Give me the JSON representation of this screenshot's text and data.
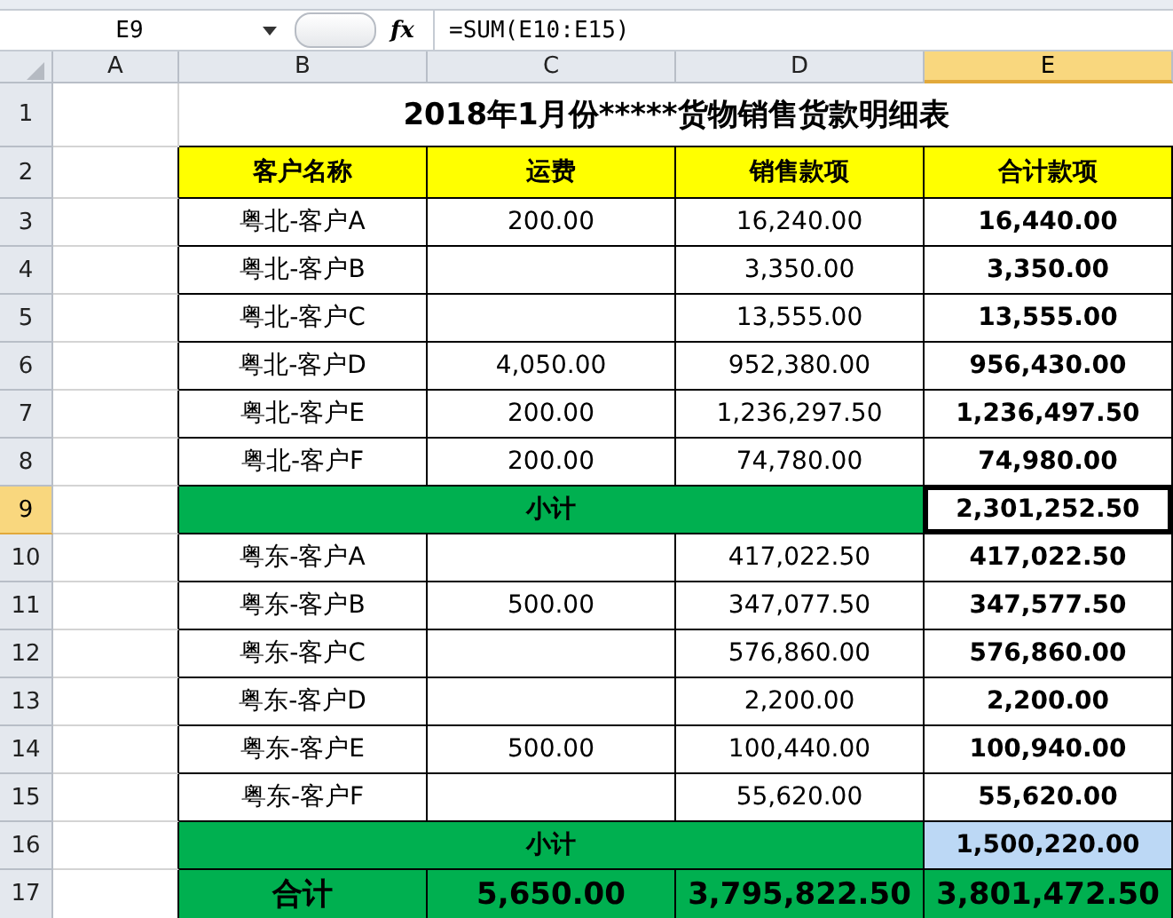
{
  "formula_bar": {
    "cell_ref": "E9",
    "function_symbol": "fx",
    "formula": "=SUM(E10:E15)"
  },
  "columns": [
    {
      "label": "A",
      "selected": false
    },
    {
      "label": "B",
      "selected": false
    },
    {
      "label": "C",
      "selected": false
    },
    {
      "label": "D",
      "selected": false
    },
    {
      "label": "E",
      "selected": true
    }
  ],
  "rows": [
    {
      "number": "1",
      "selected": false,
      "kind": "title",
      "cells": [
        {
          "text": "2018年1月份*****货物销售货款明细表"
        }
      ]
    },
    {
      "number": "2",
      "selected": false,
      "kind": "header",
      "cells": [
        {
          "text": "客户名称"
        },
        {
          "text": "运费"
        },
        {
          "text": "销售款项"
        },
        {
          "text": "合计款项"
        }
      ]
    },
    {
      "number": "3",
      "selected": false,
      "kind": "data",
      "cells": [
        {
          "text": "粤北-客户A"
        },
        {
          "text": "200.00"
        },
        {
          "text": "16,240.00"
        },
        {
          "text": "16,440.00",
          "active": false,
          "highlighted": false
        }
      ]
    },
    {
      "number": "4",
      "selected": false,
      "kind": "data",
      "cells": [
        {
          "text": "粤北-客户B"
        },
        {},
        {
          "text": "3,350.00"
        },
        {
          "text": "3,350.00",
          "active": false,
          "highlighted": false
        }
      ]
    },
    {
      "number": "5",
      "selected": false,
      "kind": "data",
      "cells": [
        {
          "text": "粤北-客户C"
        },
        {},
        {
          "text": "13,555.00"
        },
        {
          "text": "13,555.00",
          "active": false,
          "highlighted": false
        }
      ]
    },
    {
      "number": "6",
      "selected": false,
      "kind": "data",
      "cells": [
        {
          "text": "粤北-客户D"
        },
        {
          "text": "4,050.00"
        },
        {
          "text": "952,380.00"
        },
        {
          "text": "956,430.00",
          "active": false,
          "highlighted": false
        }
      ]
    },
    {
      "number": "7",
      "selected": false,
      "kind": "data",
      "cells": [
        {
          "text": "粤北-客户E"
        },
        {
          "text": "200.00"
        },
        {
          "text": "1,236,297.50"
        },
        {
          "text": "1,236,497.50",
          "active": false,
          "highlighted": false
        }
      ]
    },
    {
      "number": "8",
      "selected": false,
      "kind": "data",
      "cells": [
        {
          "text": "粤北-客户F"
        },
        {
          "text": "200.00"
        },
        {
          "text": "74,780.00"
        },
        {
          "text": "74,980.00",
          "active": false,
          "highlighted": false
        }
      ]
    },
    {
      "number": "9",
      "selected": true,
      "kind": "subtotal",
      "cells": [
        {
          "text": "小计"
        },
        {
          "text": "2,301,252.50",
          "active": true,
          "highlighted": false
        }
      ]
    },
    {
      "number": "10",
      "selected": false,
      "kind": "data",
      "cells": [
        {
          "text": "粤东-客户A"
        },
        {},
        {
          "text": "417,022.50"
        },
        {
          "text": "417,022.50",
          "active": false,
          "highlighted": false
        }
      ]
    },
    {
      "number": "11",
      "selected": false,
      "kind": "data",
      "cells": [
        {
          "text": "粤东-客户B"
        },
        {
          "text": "500.00"
        },
        {
          "text": "347,077.50"
        },
        {
          "text": "347,577.50",
          "active": false,
          "highlighted": false
        }
      ]
    },
    {
      "number": "12",
      "selected": false,
      "kind": "data",
      "cells": [
        {
          "text": "粤东-客户C"
        },
        {},
        {
          "text": "576,860.00"
        },
        {
          "text": "576,860.00",
          "active": false,
          "highlighted": false
        }
      ]
    },
    {
      "number": "13",
      "selected": false,
      "kind": "data",
      "cells": [
        {
          "text": "粤东-客户D"
        },
        {},
        {
          "text": "2,200.00"
        },
        {
          "text": "2,200.00",
          "active": false,
          "highlighted": false
        }
      ]
    },
    {
      "number": "14",
      "selected": false,
      "kind": "data",
      "cells": [
        {
          "text": "粤东-客户E"
        },
        {
          "text": "500.00"
        },
        {
          "text": "100,440.00"
        },
        {
          "text": "100,940.00",
          "active": false,
          "highlighted": false
        }
      ]
    },
    {
      "number": "15",
      "selected": false,
      "kind": "data",
      "cells": [
        {
          "text": "粤东-客户F"
        },
        {},
        {
          "text": "55,620.00"
        },
        {
          "text": "55,620.00",
          "active": false,
          "highlighted": false
        }
      ]
    },
    {
      "number": "16",
      "selected": false,
      "kind": "subtotal",
      "cells": [
        {
          "text": "小计"
        },
        {
          "text": "1,500,220.00",
          "active": false,
          "highlighted": true
        }
      ]
    },
    {
      "number": "17",
      "selected": false,
      "kind": "total",
      "cells": [
        {
          "text": "合计"
        },
        {
          "text": "5,650.00"
        },
        {
          "text": "3,795,822.50"
        },
        {
          "text": "3,801,472.50",
          "active": false,
          "highlighted": false
        }
      ]
    }
  ]
}
